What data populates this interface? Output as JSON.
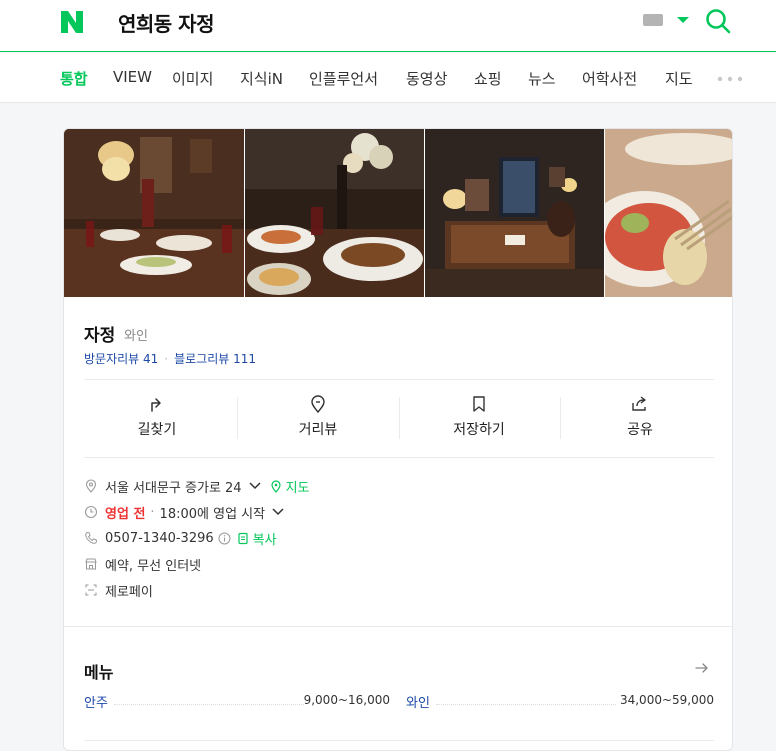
{
  "header": {
    "logo_letter": "N",
    "query": "연희동 자정",
    "brand_color": "#03c75a"
  },
  "tabs": [
    {
      "label": "통합",
      "active": true
    },
    {
      "label": "VIEW"
    },
    {
      "label": "이미지"
    },
    {
      "label": "지식iN"
    },
    {
      "label": "인플루언서"
    },
    {
      "label": "동영상"
    },
    {
      "label": "쇼핑"
    },
    {
      "label": "뉴스"
    },
    {
      "label": "어학사전"
    },
    {
      "label": "지도"
    }
  ],
  "place": {
    "name": "자정",
    "category": "와인",
    "visitor_reviews": "방문자리뷰 41",
    "blog_reviews": "블로그리뷰 111"
  },
  "actions": [
    {
      "label": "길찾기",
      "icon": "directions-icon"
    },
    {
      "label": "거리뷰",
      "icon": "map-pin-icon"
    },
    {
      "label": "저장하기",
      "icon": "bookmark-icon"
    },
    {
      "label": "공유",
      "icon": "share-icon"
    }
  ],
  "info": {
    "address": "서울 서대문구 증가로 24",
    "map_link": "지도",
    "status": "영업 전",
    "hours": "18:00에 영업 시작",
    "phone": "0507-1340-3296",
    "copy": "복사",
    "amenities": "예약, 무선 인터넷",
    "payment": "제로페이"
  },
  "menu": {
    "title": "메뉴",
    "items": [
      {
        "name": "안주",
        "price": "9,000~16,000"
      },
      {
        "name": "와인",
        "price": "34,000~59,000"
      }
    ]
  }
}
